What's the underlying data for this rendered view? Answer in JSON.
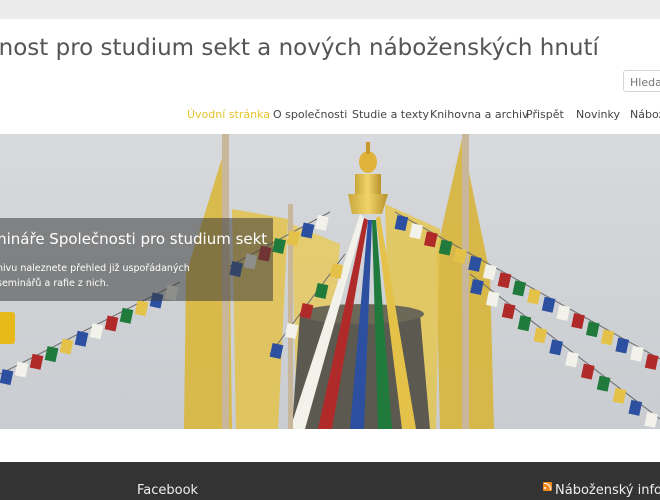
{
  "header": {
    "site_title": "čnost pro studium sekt a nových náboženských hnutí",
    "search_placeholder": "Hledat"
  },
  "nav": {
    "items": [
      {
        "label": "Úvodní stránka",
        "active": true
      },
      {
        "label": "O společnosti"
      },
      {
        "label": "Studie a texty"
      },
      {
        "label": "Knihovna a archiv"
      },
      {
        "label": "Přispět"
      },
      {
        "label": "Novinky"
      },
      {
        "label": "Nábož"
      }
    ]
  },
  "hero": {
    "caption_title": "mináře Společnosti pro studium sekt",
    "caption_text": "nivu naleznete přehled již uspořádaných seminářů a rafie z nich."
  },
  "footer": {
    "facebook_title": "Facebook",
    "rss_title": "Náboženský info"
  },
  "colors": {
    "accent": "#e6c32c",
    "footer_bg": "#333333",
    "rss": "#f28a1e"
  }
}
